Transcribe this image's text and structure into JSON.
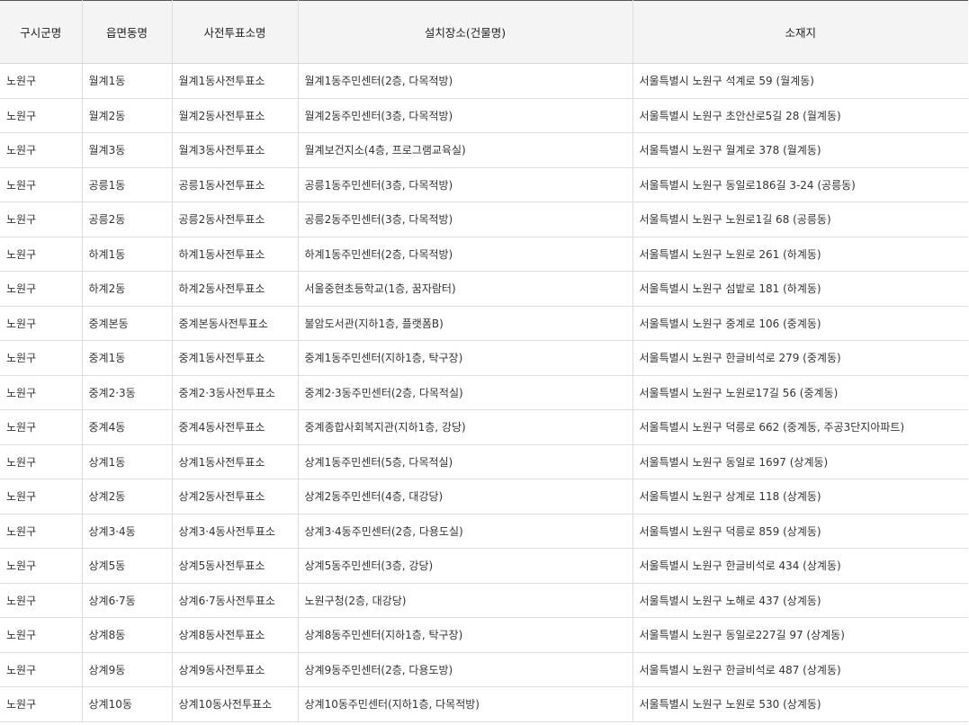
{
  "table": {
    "headers": [
      "구시군명",
      "읍면동명",
      "사전투표소명",
      "설치장소(건물명)",
      "소재지"
    ],
    "rows": [
      [
        "노원구",
        "월계1동",
        "월계1동사전투표소",
        "월계1동주민센터(2층, 다목적방)",
        "서울특별시 노원구 석계로 59 (월계동)"
      ],
      [
        "노원구",
        "월계2동",
        "월계2동사전투표소",
        "월계2동주민센터(3층, 다목적방)",
        "서울특별시 노원구 초안산로5길 28 (월계동)"
      ],
      [
        "노원구",
        "월계3동",
        "월계3동사전투표소",
        "월계보건지소(4층, 프로그램교육실)",
        "서울특별시 노원구 월계로 378 (월계동)"
      ],
      [
        "노원구",
        "공릉1동",
        "공릉1동사전투표소",
        "공릉1동주민센터(3층, 다목적방)",
        "서울특별시 노원구 동일로186길 3-24 (공릉동)"
      ],
      [
        "노원구",
        "공릉2동",
        "공릉2동사전투표소",
        "공릉2동주민센터(3층, 다목적방)",
        "서울특별시 노원구 노원로1길 68 (공릉동)"
      ],
      [
        "노원구",
        "하계1동",
        "하계1동사전투표소",
        "하계1동주민센터(2층, 다목적방)",
        "서울특별시 노원구 노원로 261 (하계동)"
      ],
      [
        "노원구",
        "하계2동",
        "하계2동사전투표소",
        "서울중현초등학교(1층, 꿈자람터)",
        "서울특별시 노원구 섬밭로 181 (하계동)"
      ],
      [
        "노원구",
        "중계본동",
        "중계본동사전투표소",
        "불암도서관(지하1층, 플랫폼B)",
        "서울특별시 노원구 중계로 106 (중계동)"
      ],
      [
        "노원구",
        "중계1동",
        "중계1동사전투표소",
        "중계1동주민센터(지하1층, 탁구장)",
        "서울특별시 노원구 한글비석로 279 (중계동)"
      ],
      [
        "노원구",
        "중계2·3동",
        "중계2·3동사전투표소",
        "중계2·3동주민센터(2층, 다목적실)",
        "서울특별시 노원구 노원로17길 56 (중계동)"
      ],
      [
        "노원구",
        "중계4동",
        "중계4동사전투표소",
        "중계종합사회복지관(지하1층, 강당)",
        "서울특별시 노원구 덕릉로 662 (중계동, 주공3단지아파트)"
      ],
      [
        "노원구",
        "상계1동",
        "상계1동사전투표소",
        "상계1동주민센터(5층, 다목적실)",
        "서울특별시 노원구 동일로 1697 (상계동)"
      ],
      [
        "노원구",
        "상계2동",
        "상계2동사전투표소",
        "상계2동주민센터(4층, 대강당)",
        "서울특별시 노원구 상계로 118 (상계동)"
      ],
      [
        "노원구",
        "상계3·4동",
        "상계3·4동사전투표소",
        "상계3·4동주민센터(2층, 다용도실)",
        "서울특별시 노원구 덕릉로 859 (상계동)"
      ],
      [
        "노원구",
        "상계5동",
        "상계5동사전투표소",
        "상계5동주민센터(3층, 강당)",
        "서울특별시 노원구 한글비석로 434 (상계동)"
      ],
      [
        "노원구",
        "상계6·7동",
        "상계6·7동사전투표소",
        "노원구청(2층, 대강당)",
        "서울특별시 노원구 노해로 437 (상계동)"
      ],
      [
        "노원구",
        "상계8동",
        "상계8동사전투표소",
        "상계8동주민센터(지하1층, 탁구장)",
        "서울특별시 노원구 동일로227길 97 (상계동)"
      ],
      [
        "노원구",
        "상계9동",
        "상계9동사전투표소",
        "상계9동주민센터(2층, 다용도방)",
        "서울특별시 노원구 한글비석로 487 (상계동)"
      ],
      [
        "노원구",
        "상계10동",
        "상계10동사전투표소",
        "상계10동주민센터(지하1층, 다목적방)",
        "서울특별시 노원구 노원로 530 (상계동)"
      ]
    ]
  }
}
